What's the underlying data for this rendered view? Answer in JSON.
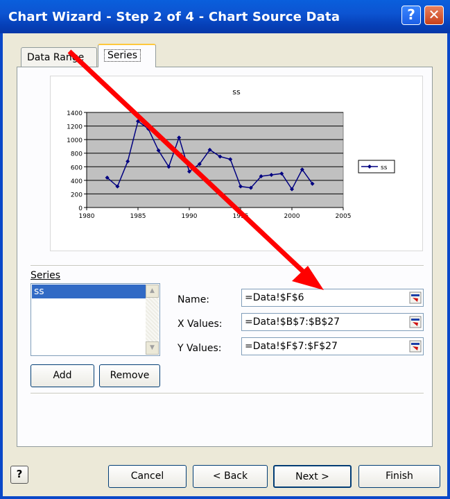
{
  "window": {
    "title": "Chart Wizard - Step 2 of 4 - Chart Source Data",
    "help_glyph": "?",
    "close_glyph": "✕"
  },
  "tabs": [
    {
      "label": "Data Range",
      "selected": false
    },
    {
      "label": "Series",
      "selected": true
    }
  ],
  "chart_data": {
    "type": "line",
    "title": "ss",
    "xlabel": "",
    "ylabel": "",
    "xlim": [
      1980,
      2005
    ],
    "ylim": [
      0,
      1400
    ],
    "x_ticks": [
      1980,
      1985,
      1990,
      1995,
      2000,
      2005
    ],
    "y_ticks": [
      0,
      200,
      400,
      600,
      800,
      1000,
      1200,
      1400
    ],
    "grid": true,
    "plot_background": "#c0c0c0",
    "legend_position": "right",
    "series": [
      {
        "name": "ss",
        "color": "#000080",
        "x": [
          1982,
          1983,
          1984,
          1985,
          1986,
          1987,
          1988,
          1989,
          1990,
          1991,
          1992,
          1993,
          1994,
          1995,
          1996,
          1997,
          1998,
          1999,
          2000,
          2001,
          2002
        ],
        "y": [
          440,
          310,
          680,
          1270,
          1160,
          840,
          600,
          1030,
          530,
          640,
          850,
          750,
          710,
          310,
          290,
          460,
          480,
          500,
          270,
          560,
          350
        ]
      }
    ]
  },
  "series_panel": {
    "label": "Series",
    "items": [
      "ss"
    ],
    "selected": "ss",
    "add_label": "Add",
    "remove_label": "Remove"
  },
  "fields": {
    "name_label": "Name:",
    "name_value": "=Data!$F$6",
    "x_label": "X Values:",
    "x_value": "=Data!$B$7:$B$27",
    "y_label": "Y Values:",
    "y_value": "=Data!$F$7:$F$27"
  },
  "buttons": {
    "help": "?",
    "cancel": "Cancel",
    "back": "< Back",
    "next": "Next >",
    "finish": "Finish"
  },
  "annotation": {
    "arrow_color": "#ff0000"
  }
}
